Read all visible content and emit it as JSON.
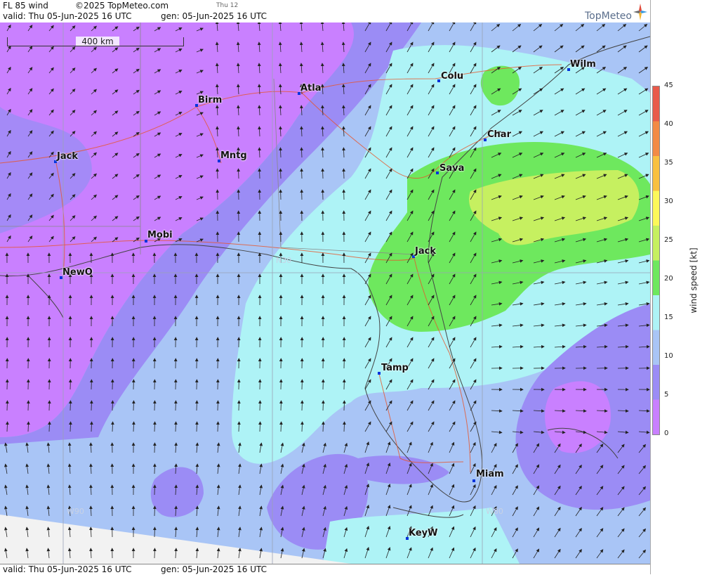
{
  "header": {
    "product": "FL 85 wind",
    "copyright": "©2025 TopMeteo.com",
    "day": "Thu 12",
    "valid": "valid:  Thu  05-Jun-2025  16 UTC",
    "gen": "gen:  05-Jun-2025 16 UTC"
  },
  "footer": {
    "valid": "valid:  Thu  05-Jun-2025  16 UTC",
    "gen": "gen:  05-Jun-2025 16 UTC"
  },
  "brand": {
    "name": "TopMeteo"
  },
  "scale_bar": {
    "label": "400 km"
  },
  "legend": {
    "title": "wind speed  [kt]",
    "ticks": [
      "45",
      "40",
      "35",
      "30",
      "25",
      "20",
      "15",
      "10",
      "5",
      "0"
    ],
    "colors": [
      "#c980ff",
      "#9b8cf5",
      "#a9c5f6",
      "#aef3f6",
      "#6ee85e",
      "#c6f060",
      "#fcf85a",
      "#f9c040",
      "#f38a45",
      "#e95a4a"
    ]
  },
  "grid_labels": {
    "lat": "N30",
    "lon1": "W90",
    "lon2": "W80"
  },
  "cities": [
    {
      "name": "Wilm"
    },
    {
      "name": "Colu"
    },
    {
      "name": "Atla"
    },
    {
      "name": "Birm"
    },
    {
      "name": "Char"
    },
    {
      "name": "Jack"
    },
    {
      "name": "Mntg"
    },
    {
      "name": "Sava"
    },
    {
      "name": "Mobi"
    },
    {
      "name": "Jack"
    },
    {
      "name": "NewO"
    },
    {
      "name": "Tamp"
    },
    {
      "name": "Miam"
    },
    {
      "name": "KeyW"
    }
  ]
}
